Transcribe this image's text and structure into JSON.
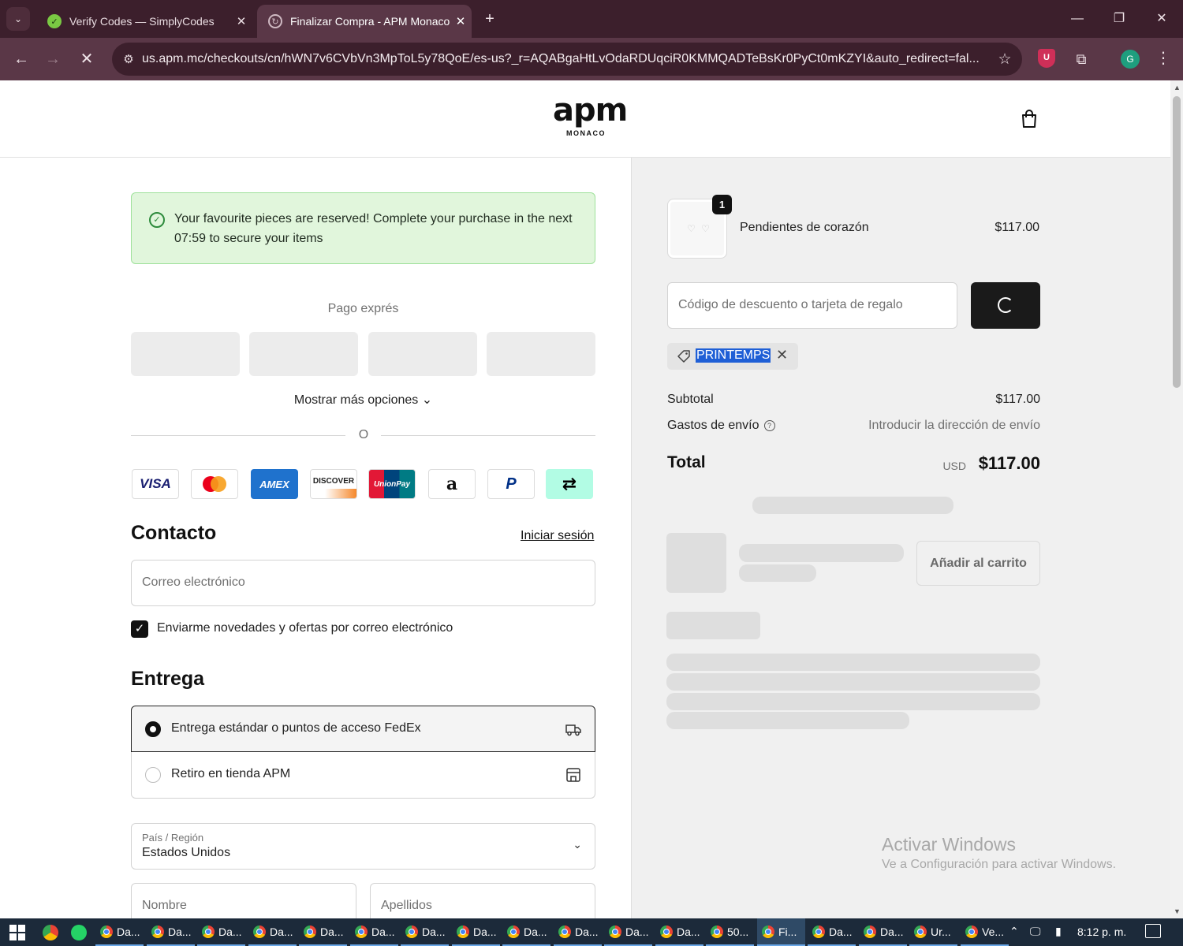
{
  "browser": {
    "tabs": [
      {
        "title": "Verify Codes — SimplyCodes",
        "close": "✕"
      },
      {
        "title": "Finalizar Compra - APM Monaco",
        "close": "✕"
      }
    ],
    "new_tab": "+",
    "url": "us.apm.mc/checkouts/cn/hWN7v6CVbVn3MpToL5y78QoE/es-us?_r=AQABgaHtLvOdaRDUqciR0KMMQADTeBsKr0PyCt0mKZYI&auto_redirect=fal...",
    "extension_ublock": "U",
    "profile_initial": "G"
  },
  "store": {
    "logo_mark": "apm",
    "logo_sub": "MONACO"
  },
  "notice": {
    "message": "Your favourite pieces are reserved! Complete your purchase in the next 07:59 to secure your items"
  },
  "express": {
    "title": "Pago exprés",
    "more_options": "Mostrar más opciones ⌄",
    "or": "O"
  },
  "payment_cards": [
    "VISA",
    "mastercard",
    "AMEX",
    "DISCOVER",
    "UnionPay",
    "amazon",
    "paypal",
    "afterpay"
  ],
  "contact": {
    "title": "Contacto",
    "login_link": "Iniciar sesión",
    "email_placeholder": "Correo electrónico",
    "newsletter_label": "Enviarme novedades y ofertas por correo electrónico",
    "newsletter_checked": true
  },
  "delivery": {
    "title": "Entrega",
    "options": [
      {
        "label": "Entrega estándar o puntos de acceso FedEx",
        "selected": true,
        "icon": "truck-icon"
      },
      {
        "label": "Retiro en tienda APM",
        "selected": false,
        "icon": "store-icon"
      }
    ],
    "country_caption": "País / Región",
    "country_value": "Estados Unidos",
    "first_name_placeholder": "Nombre",
    "last_name_placeholder": "Apellidos"
  },
  "summary": {
    "item": {
      "quantity": "1",
      "name": "Pendientes de corazón",
      "price": "$117.00"
    },
    "discount_placeholder": "Código de descuento o tarjeta de regalo",
    "applied_code": "PRINTEMPS",
    "subtotal_label": "Subtotal",
    "subtotal_value": "$117.00",
    "shipping_label": "Gastos de envío",
    "shipping_value": "Introducir la dirección de envío",
    "total_label": "Total",
    "currency": "USD",
    "total_value": "$117.00",
    "add_to_cart": "Añadir al carrito"
  },
  "watermark": {
    "title": "Activar Windows",
    "subtitle": "Ve a Configuración para activar Windows."
  },
  "taskbar": {
    "items": [
      "Da...",
      "Da...",
      "Da...",
      "Da...",
      "Da...",
      "Da...",
      "Da...",
      "Da...",
      "Da...",
      "Da...",
      "Da...",
      "Da...",
      "50...",
      "Fi...",
      "Da...",
      "Da...",
      "Ur...",
      "Ve..."
    ],
    "clock": "8:12 p. m."
  },
  "colors": {
    "chrome_dark": "#3c1f2c",
    "chrome_mid": "#5a3747",
    "notice_bg": "#e1f6dc",
    "summary_bg": "#f0f0f0",
    "highlight": "#1f5fd6"
  }
}
